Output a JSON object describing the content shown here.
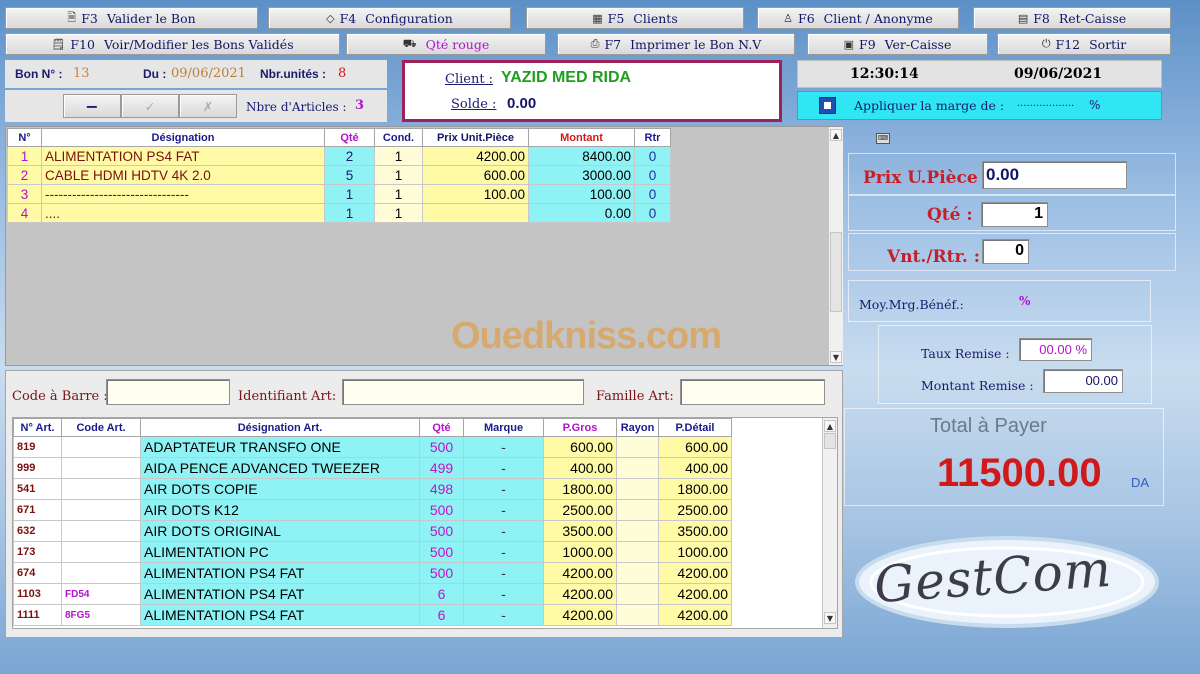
{
  "toolbar": {
    "row1": [
      {
        "key": "F3",
        "label": "Valider le Bon",
        "icon": "document-icon"
      },
      {
        "key": "F4",
        "label": "Configuration",
        "icon": "diamond-icon"
      },
      {
        "key": "F5",
        "label": "Clients",
        "icon": "calculator-icon"
      },
      {
        "key": "F6",
        "label": "Client / Anonyme",
        "icon": "person-icon"
      },
      {
        "key": "F8",
        "label": "Ret-Caisse",
        "icon": "cash-icon"
      }
    ],
    "row2": [
      {
        "key": "F10",
        "label": "Voir/Modifier les Bons Validés",
        "icon": "document-edit-icon"
      },
      {
        "key": "",
        "label": "Qté rouge",
        "icon": "car-icon"
      },
      {
        "key": "F7",
        "label": "Imprimer le Bon N.V",
        "icon": "printer-icon"
      },
      {
        "key": "F9",
        "label": "Ver-Caisse",
        "icon": "safe-icon"
      },
      {
        "key": "F12",
        "label": "Sortir",
        "icon": "exit-icon"
      }
    ]
  },
  "bon": {
    "num_label": "Bon N° :",
    "num": "13",
    "date_label": "Du :",
    "date": "09/06/2021",
    "units_label": "Nbr.unités :",
    "units": "8",
    "articles_label": "Nbre d'Articles :",
    "articles": "3",
    "minus_label": "−",
    "check_label": "✓",
    "cancel_label": "✗"
  },
  "client": {
    "label": "Client :",
    "name": "YAZID MED RIDA",
    "solde_label": "Solde :",
    "solde": "0.00"
  },
  "clock": {
    "time": "12:30:14",
    "date": "09/06/2021"
  },
  "marge": {
    "label": "Appliquer la marge de :",
    "dots": "..................",
    "pct": "%"
  },
  "cart": {
    "headers": [
      "N°",
      "Désignation",
      "Qté",
      "Cond.",
      "Prix Unit.Pièce",
      "Montant",
      "Rtr"
    ],
    "rows": [
      [
        "1",
        "ALIMENTATION PS4 FAT",
        "2",
        "1",
        "4200.00",
        "8400.00",
        "0"
      ],
      [
        "2",
        "CABLE HDMI HDTV 4K 2.0",
        "5",
        "1",
        "600.00",
        "3000.00",
        "0"
      ],
      [
        "3",
        "    --------------------------------",
        "1",
        "1",
        "100.00",
        "100.00",
        "0"
      ],
      [
        "4",
        "....",
        "1",
        "1",
        "",
        "0.00",
        "0"
      ]
    ]
  },
  "search": {
    "barcode_label": "Code à Barre :",
    "ident_label": "Identifiant Art:",
    "family_label": "Famille Art:"
  },
  "articles": {
    "headers": [
      "N° Art.",
      "Code Art.",
      "Désignation Art.",
      "Qté",
      "Marque",
      "P.Gros",
      "Rayon",
      "P.Détail"
    ],
    "rows": [
      [
        "819",
        "",
        "ADAPTATEUR TRANSFO ONE",
        "500",
        "-",
        "600.00",
        "",
        "600.00"
      ],
      [
        "999",
        "",
        "AIDA PENCE  ADVANCED TWEEZER",
        "499",
        "-",
        "400.00",
        "",
        "400.00"
      ],
      [
        "541",
        "",
        "AIR DOTS COPIE",
        "498",
        "-",
        "1800.00",
        "",
        "1800.00"
      ],
      [
        "671",
        "",
        "AIR DOTS K12",
        "500",
        "-",
        "2500.00",
        "",
        "2500.00"
      ],
      [
        "632",
        "",
        "AIR DOTS ORIGINAL",
        "500",
        "-",
        "3500.00",
        "",
        "3500.00"
      ],
      [
        "173",
        "",
        "ALIMENTATION PC",
        "500",
        "-",
        "1000.00",
        "",
        "1000.00"
      ],
      [
        "674",
        "",
        "ALIMENTATION PS4 FAT",
        "500",
        "-",
        "4200.00",
        "",
        "4200.00"
      ],
      [
        "1103",
        "FD54",
        "ALIMENTATION PS4 FAT",
        "6",
        "-",
        "4200.00",
        "",
        "4200.00"
      ],
      [
        "1111",
        "8FG5",
        "ALIMENTATION PS4 FAT",
        "6",
        "-",
        "4200.00",
        "",
        "4200.00"
      ]
    ]
  },
  "entry": {
    "prix_label": "Prix U.Pièce :",
    "prix": "0.00",
    "qte_label": "Qté :",
    "qte": "1",
    "vnt_label": "Vnt./Rtr. :",
    "vnt": "0",
    "moy_label": "Moy.Mrg.Bénéf.:",
    "moy_pct": "%",
    "taux_label": "Taux Remise :",
    "taux": "00.00 %",
    "montant_label": "Montant Remise :",
    "montant": "00.00"
  },
  "total": {
    "label": "Total à Payer",
    "value": "11500.00",
    "currency": "DA"
  },
  "watermark": "Ouedkniss.com",
  "logo": "GestCom",
  "colors": {
    "red": "#d01a1a",
    "green": "#1f9e1f",
    "navy": "#141468",
    "yellow": "#fffaa6",
    "cyan": "#8ff3f5",
    "purple": "#b014c9"
  }
}
